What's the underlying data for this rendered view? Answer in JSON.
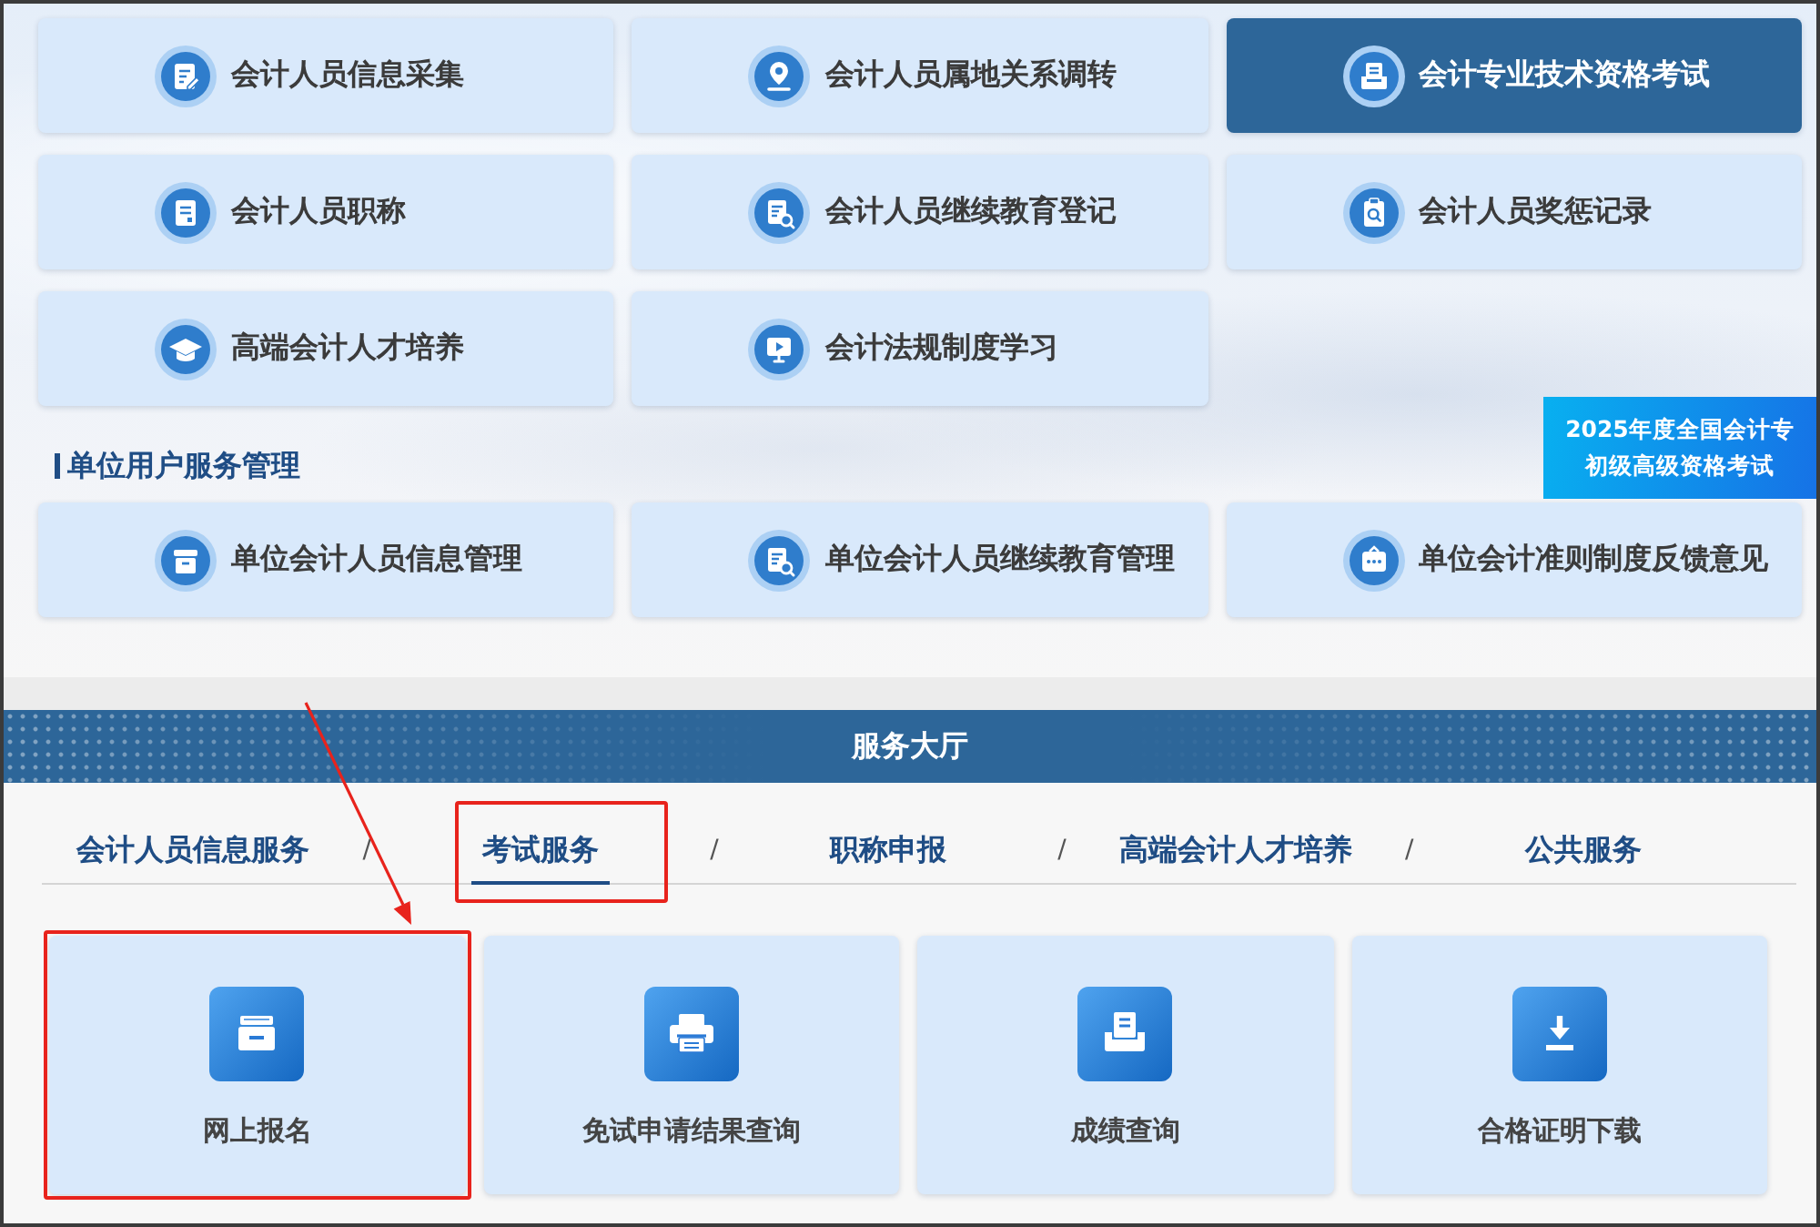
{
  "personal_services": {
    "items": [
      {
        "label": "会计人员信息采集",
        "selected": false
      },
      {
        "label": "会计人员属地关系调转",
        "selected": false
      },
      {
        "label": "会计专业技术资格考试",
        "selected": true
      },
      {
        "label": "会计人员职称",
        "selected": false
      },
      {
        "label": "会计人员继续教育登记",
        "selected": false
      },
      {
        "label": "会计人员奖惩记录",
        "selected": false
      },
      {
        "label": "高端会计人才培养",
        "selected": false
      },
      {
        "label": "会计法规制度学习",
        "selected": false
      }
    ]
  },
  "unit_services": {
    "title": "单位用户服务管理",
    "items": [
      {
        "label": "单位会计人员信息管理"
      },
      {
        "label": "单位会计人员继续教育管理"
      },
      {
        "label": "单位会计准则制度反馈意见"
      }
    ]
  },
  "notice_banner": {
    "lines": [
      "2025年度全国会计专",
      "初级高级资格考试"
    ]
  },
  "service_hall": {
    "title": "服务大厅",
    "tabs": [
      {
        "label": "会计人员信息服务",
        "selected": false,
        "highlighted": false
      },
      {
        "label": "考试服务",
        "selected": true,
        "highlighted": true
      },
      {
        "label": "职称申报",
        "selected": false,
        "highlighted": false
      },
      {
        "label": "高端会计人才培养",
        "selected": false,
        "highlighted": false
      },
      {
        "label": "公共服务",
        "selected": false,
        "highlighted": false
      }
    ],
    "tab_separators": [
      "/",
      "/",
      "/",
      "/"
    ],
    "items": [
      {
        "label": "网上报名",
        "highlighted": true
      },
      {
        "label": "免试申请结果查询",
        "highlighted": false
      },
      {
        "label": "成绩查询",
        "highlighted": false
      },
      {
        "label": "合格证明下载",
        "highlighted": false
      }
    ]
  },
  "annotation_arrow": true
}
